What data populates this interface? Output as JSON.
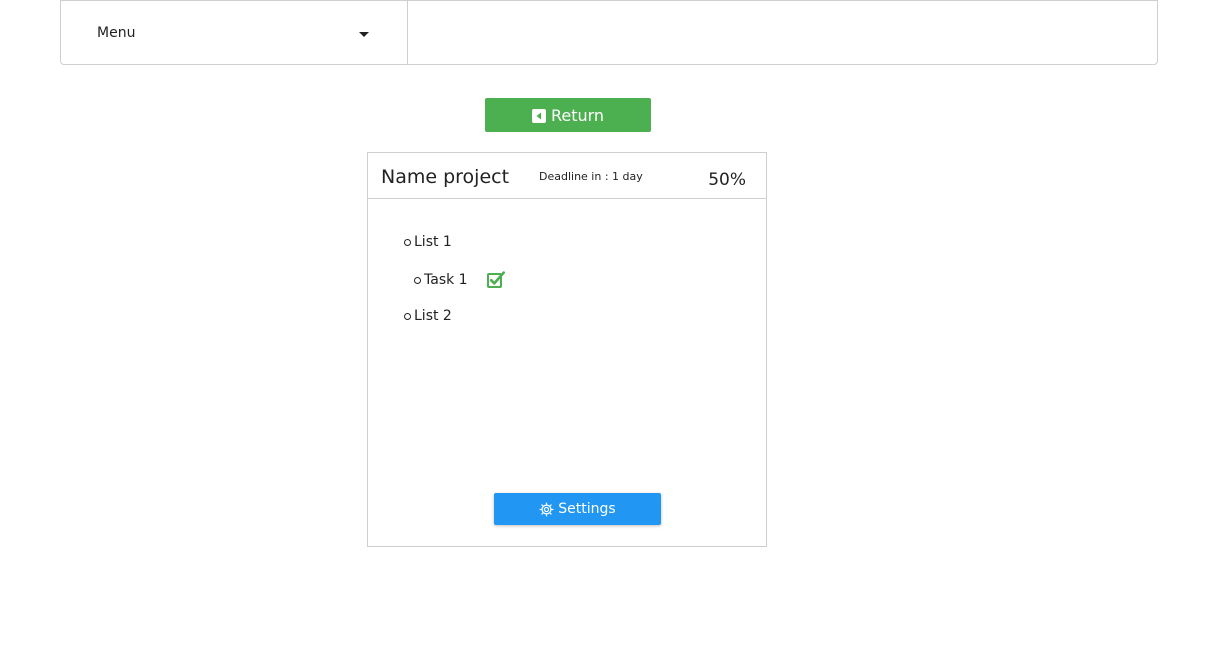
{
  "nav": {
    "menu_label": "Menu"
  },
  "actions": {
    "return_label": "Return"
  },
  "project": {
    "name": "Name project",
    "deadline": "Deadline in : 1 day",
    "progress_text": "50%",
    "progress_value": 0.5,
    "items": [
      {
        "label": "List 1",
        "type": "list",
        "level": 1
      },
      {
        "label": "Task 1",
        "type": "task",
        "level": 2,
        "completed": true
      },
      {
        "label": "List 2",
        "type": "list",
        "level": 1
      }
    ],
    "settings_label": "Settings"
  },
  "colors": {
    "return_button": "#4caf50",
    "settings_button": "#2196f3",
    "checkbox": "#4caf50",
    "border": "#cfcfcf"
  },
  "icons": {
    "return": "caret-left-square-icon",
    "settings": "gear-icon",
    "checkbox": "check-square-icon",
    "dropdown": "caret-down-icon"
  }
}
